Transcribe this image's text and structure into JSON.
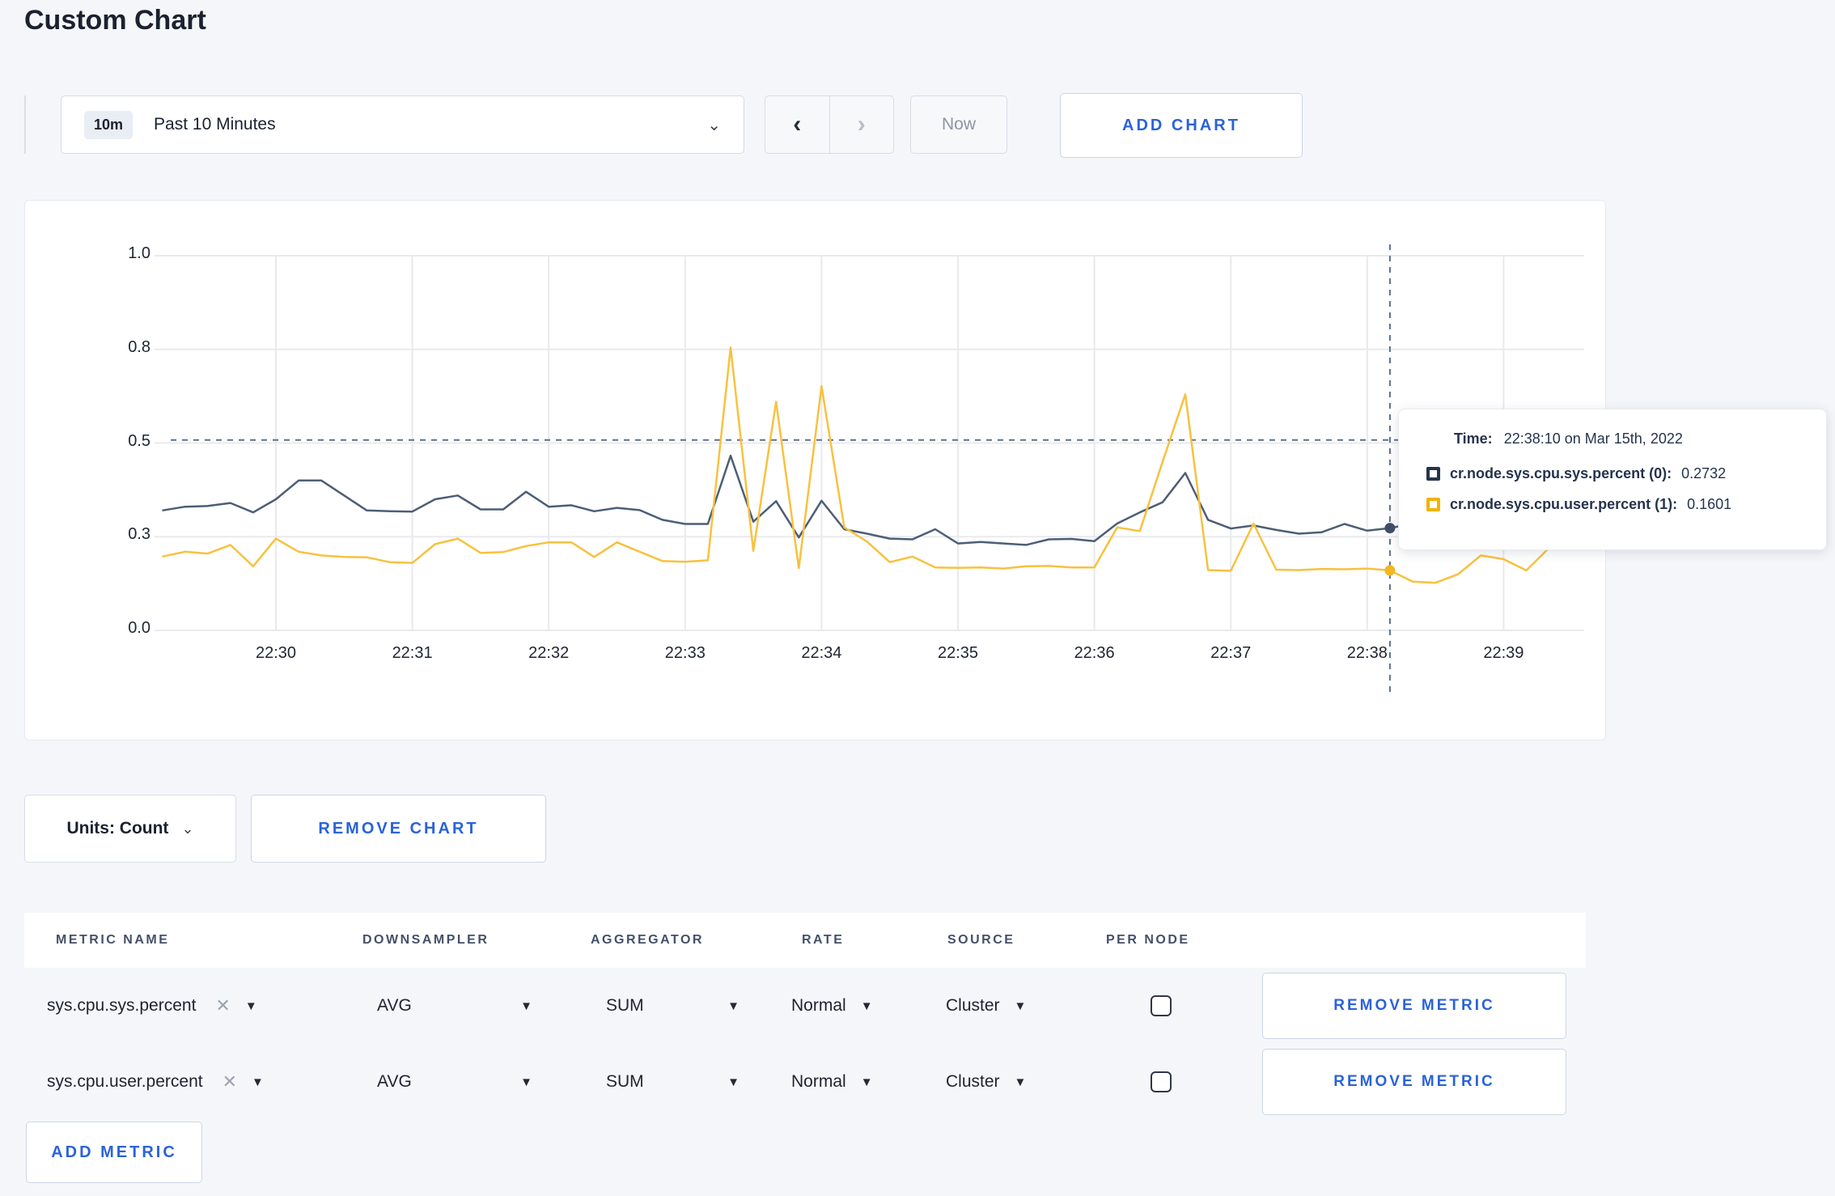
{
  "page": {
    "title": "Custom Chart"
  },
  "toolbar": {
    "range_badge": "10m",
    "range_label": "Past 10 Minutes",
    "prev_label": "‹",
    "next_label": "›",
    "now_label": "Now",
    "add_chart_label": "ADD CHART"
  },
  "chart_controls": {
    "units_label": "Units: Count",
    "remove_chart_label": "REMOVE CHART"
  },
  "tooltip": {
    "time_label": "Time:",
    "time_value": "22:38:10 on Mar 15th, 2022",
    "series": [
      {
        "name": "cr.node.sys.cpu.sys.percent (0):",
        "value": "0.2732"
      },
      {
        "name": "cr.node.sys.cpu.user.percent (1):",
        "value": "0.1601"
      }
    ]
  },
  "chart_data": {
    "type": "line",
    "title": "",
    "xlabel": "",
    "ylabel": "",
    "grid": true,
    "legend_position": "tooltip-only",
    "y_domain": [
      0,
      1
    ],
    "y_ticks": [
      {
        "label": "0.0",
        "at": 0.0
      },
      {
        "label": "0.3",
        "at": 0.25
      },
      {
        "label": "0.5",
        "at": 0.5
      },
      {
        "label": "0.8",
        "at": 0.75
      },
      {
        "label": "1.0",
        "at": 1.0
      }
    ],
    "x_ticks": [
      "22:30",
      "22:31",
      "22:32",
      "22:33",
      "22:34",
      "22:35",
      "22:36",
      "22:37",
      "22:38",
      "22:39"
    ],
    "x_start": "22:29:10",
    "x_end": "22:39:30",
    "x_step_seconds": 10,
    "crosshair": {
      "time": "22:38:10",
      "y_value": 0.508
    },
    "colors": {
      "sys": "#4d5e77",
      "user": "#f8c13f",
      "grid": "#e9eaed",
      "crosshair": "#5c7089"
    },
    "series": [
      {
        "name": "cr.node.sys.cpu.sys.percent",
        "color": "#4d5e77",
        "values": [
          0.32,
          0.33,
          0.332,
          0.34,
          0.315,
          0.35,
          0.4,
          0.4,
          0.36,
          0.32,
          0.318,
          0.317,
          0.35,
          0.36,
          0.323,
          0.323,
          0.37,
          0.33,
          0.334,
          0.318,
          0.327,
          0.321,
          0.295,
          0.284,
          0.284,
          0.466,
          0.29,
          0.345,
          0.248,
          0.346,
          0.27,
          0.258,
          0.245,
          0.243,
          0.27,
          0.232,
          0.236,
          0.232,
          0.228,
          0.243,
          0.244,
          0.238,
          0.285,
          0.315,
          0.342,
          0.42,
          0.295,
          0.272,
          0.28,
          0.268,
          0.258,
          0.262,
          0.284,
          0.266,
          0.273,
          0.285,
          0.3,
          0.295,
          0.3,
          0.31,
          0.3,
          0.31,
          0.315
        ]
      },
      {
        "name": "cr.node.sys.cpu.user.percent",
        "color": "#f8c13f",
        "values": [
          0.197,
          0.21,
          0.205,
          0.228,
          0.171,
          0.245,
          0.21,
          0.2,
          0.196,
          0.195,
          0.182,
          0.18,
          0.23,
          0.245,
          0.207,
          0.209,
          0.225,
          0.235,
          0.235,
          0.196,
          0.235,
          0.21,
          0.185,
          0.183,
          0.187,
          0.755,
          0.212,
          0.61,
          0.166,
          0.652,
          0.275,
          0.237,
          0.182,
          0.197,
          0.168,
          0.167,
          0.168,
          0.165,
          0.171,
          0.172,
          0.168,
          0.168,
          0.275,
          0.265,
          0.45,
          0.63,
          0.161,
          0.159,
          0.285,
          0.162,
          0.161,
          0.164,
          0.163,
          0.165,
          0.16,
          0.13,
          0.127,
          0.15,
          0.2,
          0.19,
          0.16,
          0.22,
          0.26
        ]
      }
    ]
  },
  "metrics_table": {
    "headers": [
      "METRIC NAME",
      "DOWNSAMPLER",
      "AGGREGATOR",
      "RATE",
      "SOURCE",
      "PER NODE"
    ],
    "rows": [
      {
        "metric": "sys.cpu.sys.percent",
        "remove_icon": "✕",
        "downsampler": "AVG",
        "aggregator": "SUM",
        "rate": "Normal",
        "source": "Cluster",
        "per_node_checked": false,
        "remove_label": "REMOVE METRIC"
      },
      {
        "metric": "sys.cpu.user.percent",
        "remove_icon": "✕",
        "downsampler": "AVG",
        "aggregator": "SUM",
        "rate": "Normal",
        "source": "Cluster",
        "per_node_checked": false,
        "remove_label": "REMOVE METRIC"
      }
    ],
    "add_metric_label": "ADD METRIC"
  }
}
